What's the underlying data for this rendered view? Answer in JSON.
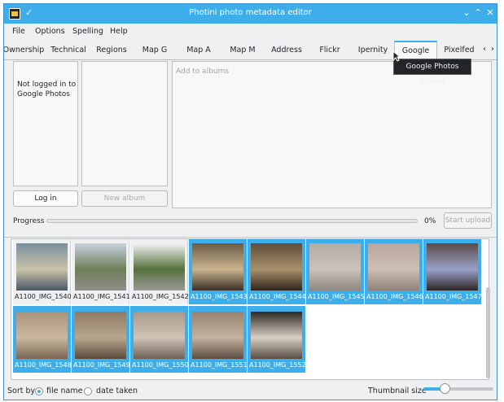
{
  "window": {
    "title": "Photini photo metadata editor",
    "controls": [
      "chevron-down-icon",
      "chevron-up-icon",
      "close-icon"
    ]
  },
  "menu": [
    "File",
    "Options",
    "Spelling",
    "Help"
  ],
  "tabs": [
    {
      "label": "Ownership",
      "active": false
    },
    {
      "label": "Technical",
      "active": false
    },
    {
      "label": "Regions",
      "active": false
    },
    {
      "label": "Map G",
      "active": false
    },
    {
      "label": "Map A",
      "active": false
    },
    {
      "label": "Map M",
      "active": false
    },
    {
      "label": "Address",
      "active": false
    },
    {
      "label": "Flickr",
      "active": false
    },
    {
      "label": "Ipernity",
      "active": false
    },
    {
      "label": "Google",
      "active": true
    },
    {
      "label": "Pixelfed",
      "active": false
    }
  ],
  "tooltip": "Google Photos upload",
  "upload": {
    "status": "Not logged in to Google Photos",
    "albums_placeholder": "Add to albums",
    "login_label": "Log in",
    "new_album_label": "New album",
    "progress_label": "Progress",
    "progress_percent": 0,
    "progress_text": "0%",
    "start_upload_label": "Start upload"
  },
  "thumbnails": [
    {
      "name": "A1100_IMG_1540",
      "selected": false,
      "colors": [
        "#7a8f9e",
        "#c9c2a8",
        "#4a5a66"
      ]
    },
    {
      "name": "A1100_IMG_1541",
      "selected": false,
      "colors": [
        "#c7d3dc",
        "#6f7d5a",
        "#8d8f8a"
      ]
    },
    {
      "name": "A1100_IMG_1542",
      "selected": false,
      "colors": [
        "#f2f4f5",
        "#55703a",
        "#9a9b98"
      ]
    },
    {
      "name": "A1100_IMG_1543",
      "selected": true,
      "colors": [
        "#6b5a44",
        "#c9b48e",
        "#3b3127"
      ]
    },
    {
      "name": "A1100_IMG_1544",
      "selected": true,
      "colors": [
        "#5e4c3a",
        "#a8906c",
        "#2f261d"
      ]
    },
    {
      "name": "A1100_IMG_1545",
      "selected": true,
      "colors": [
        "#b2aba4",
        "#c9c3bc",
        "#8f8780"
      ]
    },
    {
      "name": "A1100_IMG_1546",
      "selected": true,
      "colors": [
        "#b7a69c",
        "#cdbfb5",
        "#8f8178"
      ]
    },
    {
      "name": "A1100_IMG_1547",
      "selected": true,
      "colors": [
        "#5a4a48",
        "#9aa2c8",
        "#2e2625"
      ]
    },
    {
      "name": "A1100_IMG_1548",
      "selected": true,
      "colors": [
        "#a9927a",
        "#cbb89f",
        "#7a6652"
      ]
    },
    {
      "name": "A1100_IMG_1549",
      "selected": true,
      "colors": [
        "#8f7a66",
        "#b8a690",
        "#5b4b3c"
      ]
    },
    {
      "name": "A1100_IMG_1550",
      "selected": true,
      "colors": [
        "#a8998c",
        "#cfc3b6",
        "#6f6257"
      ]
    },
    {
      "name": "A1100_IMG_1551",
      "selected": true,
      "colors": [
        "#96836f",
        "#c2b29f",
        "#5d4f41"
      ]
    },
    {
      "name": "A1100_IMG_1552",
      "selected": true,
      "colors": [
        "#2c2622",
        "#d8d0c4",
        "#5a4e44"
      ]
    }
  ],
  "bottom": {
    "sort_by_label": "Sort by",
    "sort_options": [
      {
        "label": "file name",
        "checked": true
      },
      {
        "label": "date taken",
        "checked": false
      }
    ],
    "thumbnail_size_label": "Thumbnail size",
    "thumbnail_size_value": 0.3
  },
  "colors": {
    "accent": "#3daee9",
    "window_bg": "#eff0f1",
    "text": "#232629"
  }
}
